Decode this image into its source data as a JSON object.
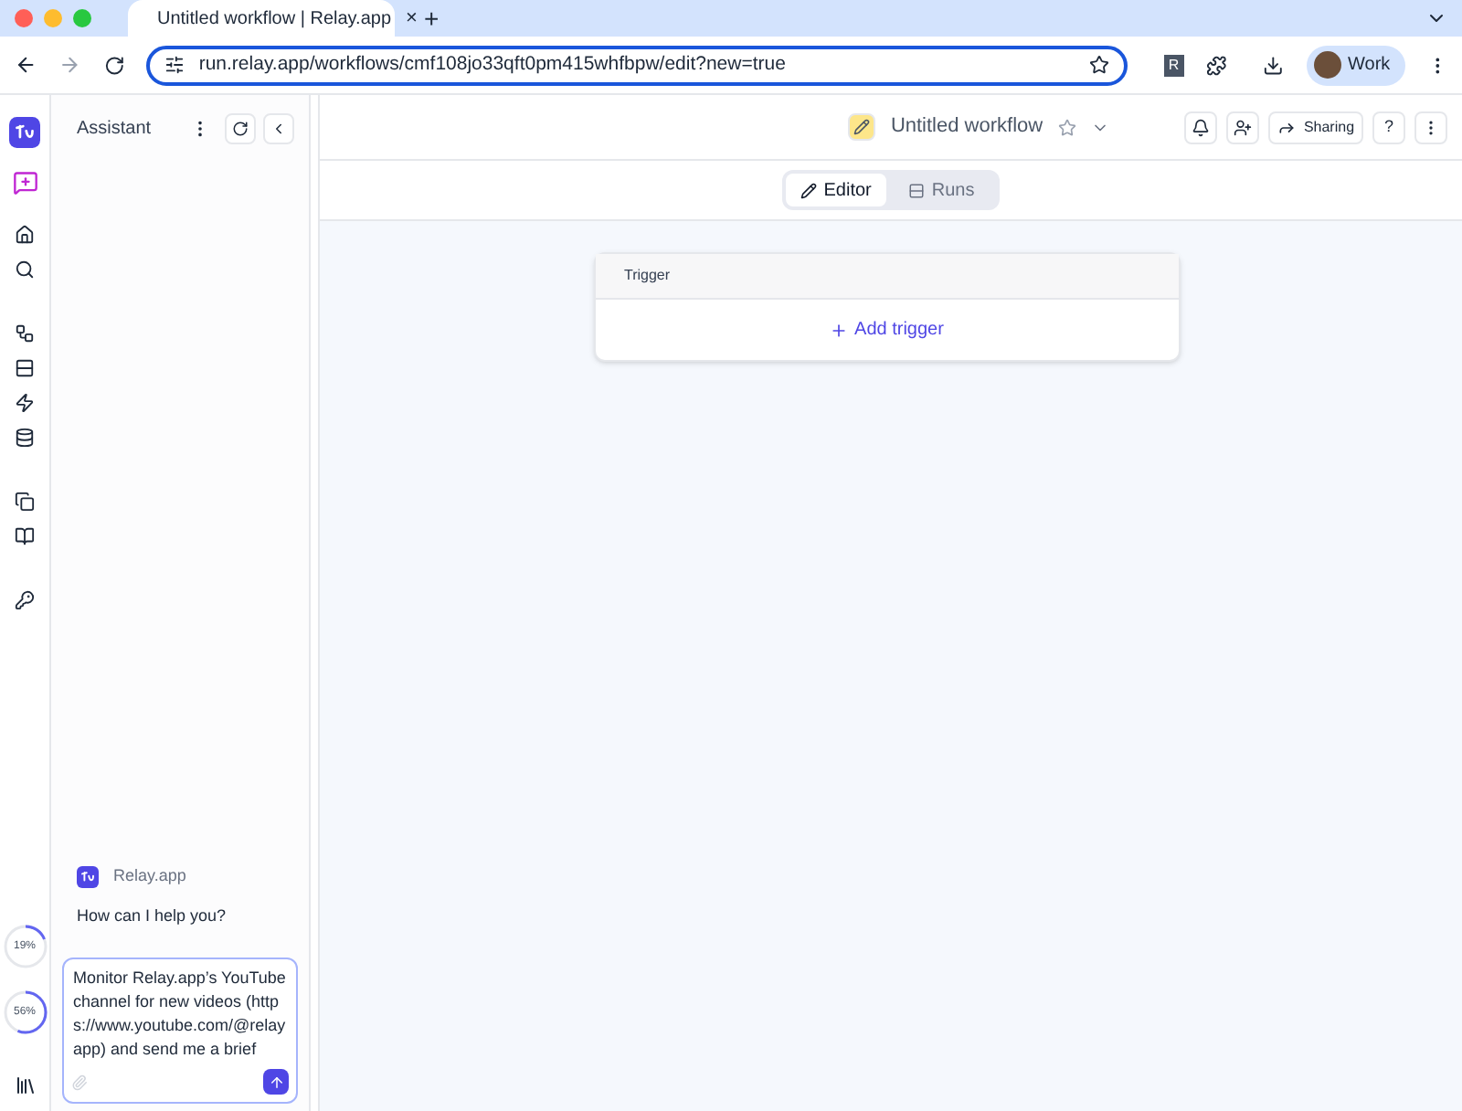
{
  "browser": {
    "tab": {
      "title": "Untitled workflow | Relay.app",
      "close": "×"
    },
    "new_tab": "+",
    "url": "run.relay.app/workflows/cmf108jo33qft0pm415whfbpw/edit?new=true",
    "extension_badge": "R",
    "profile": "Work"
  },
  "assistant": {
    "title": "Assistant",
    "sender": "Relay.app",
    "greeting": "How can I help you?",
    "message": "Monitor Relay.app’s YouTube channel for new videos (https://www.youtube.com/@relayapp) and send me a brief"
  },
  "usage": [
    {
      "reading": "19%",
      "level": 0.19
    },
    {
      "reading": "56%",
      "level": 0.56
    }
  ],
  "header": {
    "title": "Untitled workflow",
    "sharing": "Sharing",
    "help": "?"
  },
  "tabs": [
    {
      "label": "Editor",
      "selected": true
    },
    {
      "label": "Runs",
      "selected": false
    }
  ],
  "trigger": {
    "title": "Trigger",
    "action": "Add trigger"
  }
}
